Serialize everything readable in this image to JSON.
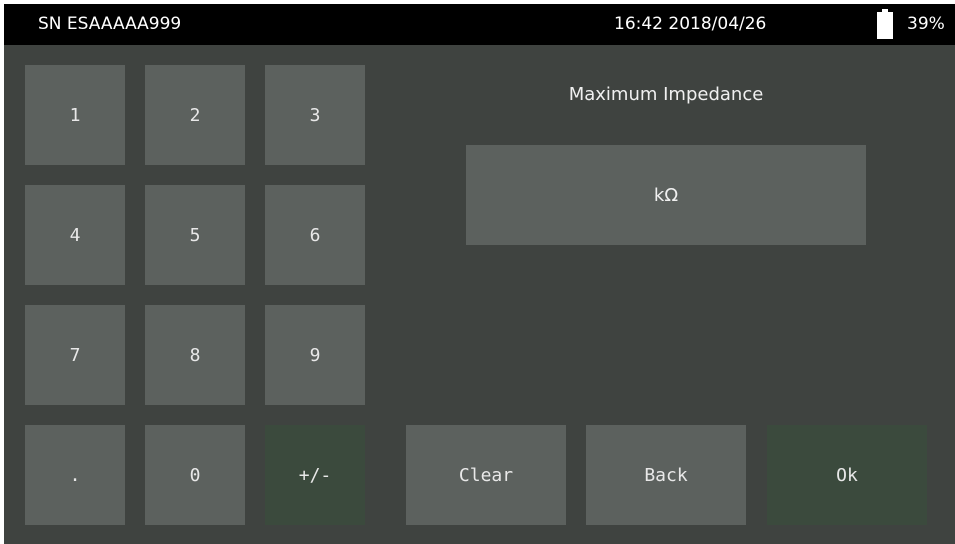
{
  "status_bar": {
    "serial": "SN ESAAAAA999",
    "datetime": "16:42 2018/04/26",
    "battery_icon": "battery-icon",
    "battery_percent": "39%"
  },
  "keypad": {
    "keys": [
      "1",
      "2",
      "3",
      "4",
      "5",
      "6",
      "7",
      "8",
      "9",
      ".",
      "0",
      "+/-"
    ]
  },
  "entry": {
    "title": "Maximum Impedance",
    "value": "",
    "unit": "kΩ"
  },
  "actions": {
    "clear_label": "Clear",
    "back_label": "Back",
    "ok_label": "Ok"
  },
  "colors": {
    "background": "#3f4340",
    "button": "#5c615e",
    "button_accent": "#3b4a3d",
    "status_bar": "#000000",
    "text": "#f0f0f0"
  }
}
